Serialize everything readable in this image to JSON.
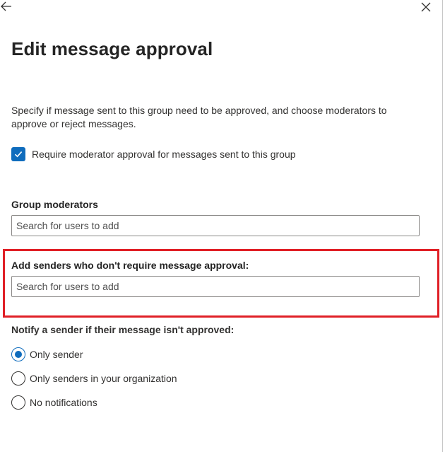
{
  "header": {
    "back_icon": "arrow-left-icon",
    "close_icon": "close-icon",
    "title": "Edit message approval"
  },
  "description": "Specify if message sent to this group need to be approved, and choose moderators to approve or reject messages.",
  "require_approval": {
    "label": "Require moderator approval for messages sent to this group",
    "checked": true
  },
  "group_moderators": {
    "label": "Group moderators",
    "placeholder": "Search for users to add"
  },
  "exempt_senders": {
    "label": "Add senders who don't require message approval:",
    "placeholder": "Search for users to add"
  },
  "notify": {
    "label": "Notify a sender if their message isn't approved:",
    "options": [
      {
        "label": "Only sender",
        "selected": true
      },
      {
        "label": "Only senders in your organization",
        "selected": false
      },
      {
        "label": "No notifications",
        "selected": false
      }
    ]
  },
  "colors": {
    "accent": "#0f6cbd",
    "highlight": "#e01f26"
  }
}
